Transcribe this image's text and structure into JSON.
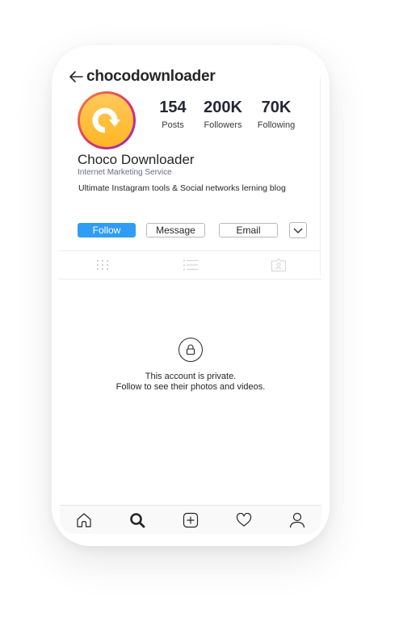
{
  "header": {
    "back_icon": "arrow-left-icon",
    "username": "chocodownloader"
  },
  "profile": {
    "avatar_icon": "refresh-arrow-icon",
    "stats": [
      {
        "value": "154",
        "label": "Posts"
      },
      {
        "value": "200K",
        "label": "Followers"
      },
      {
        "value": "70K",
        "label": "Following"
      }
    ],
    "display_name": "Choco Downloader",
    "category": "Internet Marketing Service",
    "bio": "Ultimate Instagram tools & Social networks lerning blog"
  },
  "actions": {
    "follow_label": "Follow",
    "message_label": "Message",
    "email_label": "Email",
    "more_icon": "chevron-down-icon"
  },
  "tabs": [
    {
      "icon": "grid-icon"
    },
    {
      "icon": "list-icon"
    },
    {
      "icon": "tagged-icon"
    }
  ],
  "private": {
    "icon": "lock-icon",
    "line1": "This account is private.",
    "line2": "Follow to see their photos and videos."
  },
  "bottom_nav": [
    {
      "icon": "home-icon"
    },
    {
      "icon": "search-icon",
      "active": true
    },
    {
      "icon": "add-post-icon"
    },
    {
      "icon": "heart-icon"
    },
    {
      "icon": "profile-icon"
    }
  ],
  "colors": {
    "accent": "#2f9df4",
    "avatar_fill": "#ffb623",
    "text": "#262626"
  }
}
